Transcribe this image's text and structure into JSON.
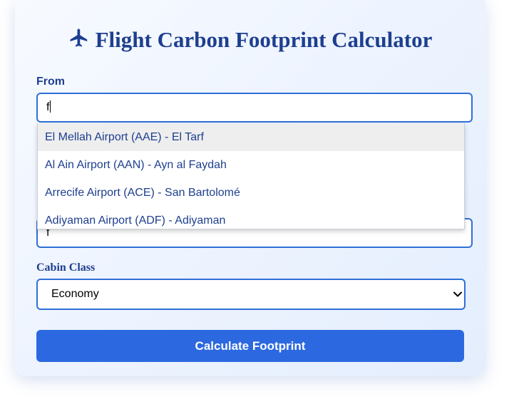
{
  "header": {
    "icon": "airplane-icon",
    "title": "Flight Carbon Footprint Calculator"
  },
  "from": {
    "label": "From",
    "value": "f"
  },
  "suggestions": [
    {
      "text": "El Mellah Airport (AAE) - El Tarf"
    },
    {
      "text": "Al Ain Airport (AAN) - Ayn al Faydah"
    },
    {
      "text": "Arrecife Airport (ACE) - San Bartolomé"
    },
    {
      "text": "Adiyaman Airport (ADF) - Adiyaman"
    }
  ],
  "to": {
    "value": "f"
  },
  "cabin": {
    "label": "Cabin Class",
    "selected": "Economy"
  },
  "button": {
    "label": "Calculate Footprint"
  },
  "colors": {
    "title": "#1e3f8f",
    "accent": "#2c69e0",
    "input_border": "#2f6fd6"
  }
}
